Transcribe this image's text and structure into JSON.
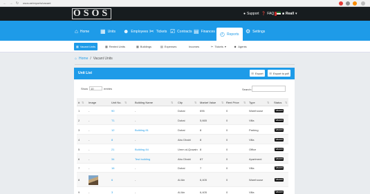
{
  "browser": {
    "url": "osos.ae/reports/vacant"
  },
  "header": {
    "logo": "OSOS",
    "support": "Support",
    "faq": "FAQ",
    "user": "Reall"
  },
  "nav": {
    "home": "Home",
    "units": "Units",
    "employees": "Employees",
    "tickets": "Tickets",
    "contracts": "Contracts",
    "finances": "Finances",
    "reports": "Reports",
    "settings": "Settings"
  },
  "subnav": {
    "vacant_units": "Vacant Units",
    "rented_units": "Rented Units",
    "buildings": "Buildings",
    "expenses": "Expenses",
    "incomes": "Incomes",
    "tickets": "Tickets",
    "agents": "Agents"
  },
  "breadcrumb": {
    "home": "Home",
    "sep": "/",
    "current": "Vacant Units"
  },
  "panel": {
    "title": "Unit List",
    "export": "Export",
    "export_pdf": "Export to pdf"
  },
  "controls": {
    "show": "Show",
    "entries_value": "10",
    "entries": "entries",
    "search": "Search:"
  },
  "table": {
    "headers": {
      "idx": "#",
      "image": "Image",
      "unit_no": "Unit No.",
      "building": "Building Name",
      "city": "City",
      "market_value": "Market Value",
      "rent_price": "Rent Price",
      "type": "Type",
      "status": "Status"
    },
    "rows": [
      {
        "idx": "1",
        "image": "-",
        "unit": "90",
        "building": "-",
        "city": "Dubai",
        "market": "696",
        "rent": "0",
        "type": "Warehouse",
        "status": "Vacant"
      },
      {
        "idx": "2",
        "image": "-",
        "unit": "T1",
        "building": "-",
        "city": "Dubai",
        "market": "5,665",
        "rent": "0",
        "type": "Villa",
        "status": "Vacant"
      },
      {
        "idx": "3",
        "image": "-",
        "unit": "12",
        "building": "Building 81",
        "city": "Dubai",
        "market": "8",
        "rent": "0",
        "type": "Parking",
        "status": "Vacant"
      },
      {
        "idx": "4",
        "image": "-",
        "unit": "8",
        "building": "-",
        "city": "Abu Dhabi",
        "market": "8",
        "rent": "0",
        "type": "Villa",
        "status": "Vacant"
      },
      {
        "idx": "5",
        "image": "-",
        "unit": "21",
        "building": "Building 84",
        "city": "Umm al-Quwain",
        "market": "8",
        "rent": "0",
        "type": "Office",
        "status": "Vacant"
      },
      {
        "idx": "6",
        "image": "-",
        "unit": "34",
        "building": "Test building",
        "city": "Abu Dhabi",
        "market": "87",
        "rent": "0",
        "type": "Apartment",
        "status": "Vacant"
      },
      {
        "idx": "7",
        "image": "-",
        "unit": "16",
        "building": "-",
        "city": "Dubai",
        "market": "7",
        "rent": "0",
        "type": "Villa",
        "status": "Vacant"
      },
      {
        "idx": "8",
        "image": "",
        "unit": "6",
        "building": "-",
        "city": "Al Ain",
        "market": "6,405",
        "rent": "0",
        "type": "Warehouse",
        "status": "Vacant"
      },
      {
        "idx": "9",
        "image": "-",
        "unit": "3",
        "building": "-",
        "city": "Al Ain",
        "market": "6,405",
        "rent": "0",
        "type": "Villa",
        "status": "Vacant"
      }
    ]
  },
  "colors": {
    "accent": "#1e9be8",
    "topbar": "#171c1f",
    "badge": "#111111"
  }
}
